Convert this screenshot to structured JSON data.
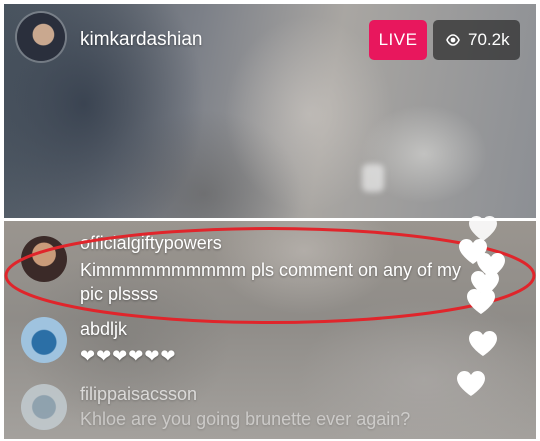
{
  "header": {
    "username": "kimkardashian",
    "live_label": "LIVE",
    "viewer_count": "70.2k",
    "viewer_icon": "eye-icon"
  },
  "comments": [
    {
      "username": "officialgiftypowers",
      "text": "Kimmmmmmmmmm pls comment on any of my pic plssss",
      "highlighted": true
    },
    {
      "username": "abdljk",
      "text": "❤❤❤❤❤❤"
    },
    {
      "username": "filippaisacsson",
      "text": "Khloe are you going brunette ever again?"
    }
  ],
  "colors": {
    "live_badge": "#e8175d",
    "highlight_outline": "#e0252b",
    "heart": "#ffffff"
  }
}
